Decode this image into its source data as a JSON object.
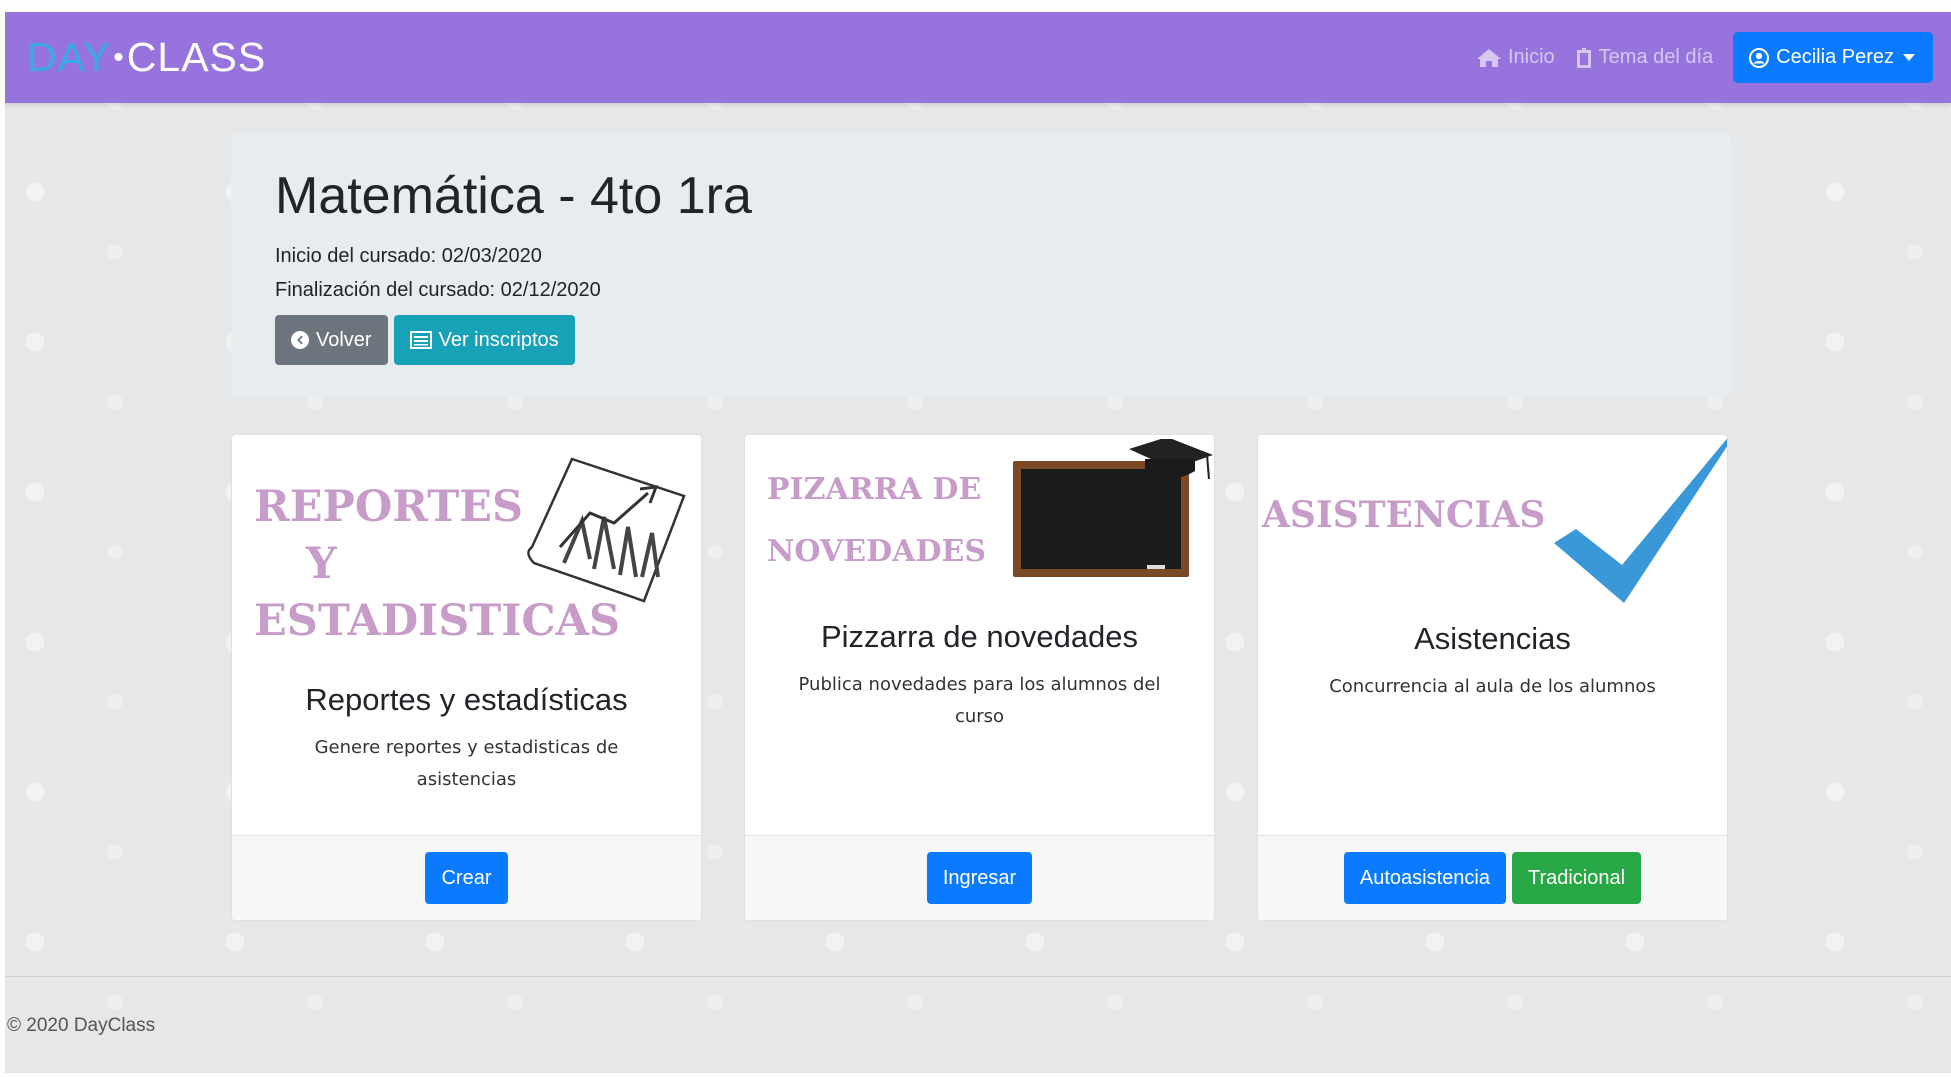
{
  "brand": {
    "day": "DAY",
    "dot": "•",
    "class": "CLASS"
  },
  "nav": {
    "home_label": "Inicio",
    "topic_label": "Tema del día",
    "user_label": "Cecilia Perez"
  },
  "course": {
    "title": "Matemática - 4to 1ra",
    "start": "Inicio del cursado: 02/03/2020",
    "end": "Finalización del cursado: 02/12/2020",
    "back_label": "Volver",
    "enrolled_label": "Ver inscriptos"
  },
  "cards": [
    {
      "image_text": [
        "REPORTES",
        "Y",
        "ESTADISTICAS"
      ],
      "title": "Reportes y estadísticas",
      "text": "Genere reportes y estadisticas de asistencias",
      "buttons": [
        "Crear"
      ]
    },
    {
      "image_text": [
        "PIZARRA DE",
        "NOVEDADES"
      ],
      "title": "Pizzarra de novedades",
      "text": "Publica novedades para los alumnos del curso",
      "buttons": [
        "Ingresar"
      ]
    },
    {
      "image_text": [
        "ASISTENCIAS"
      ],
      "title": "Asistencias",
      "text": "Concurrencia al aula de los alumnos",
      "buttons": [
        "Autoasistencia",
        "Tradicional"
      ]
    }
  ],
  "footer": {
    "text": "© 2020 DayClass"
  },
  "colors": {
    "navbar": "#9673dd",
    "primary": "#0a7bff",
    "info": "#17a2b8",
    "secondary": "#6c757d",
    "success": "#28a745",
    "image_title": "#c79cc9",
    "check": "#3a97d8"
  },
  "icons": {
    "home": "home-icon",
    "topic": "clipboard-icon",
    "user": "user-circle-icon",
    "back": "arrow-left-circle-icon",
    "enrolled": "list-icon"
  }
}
